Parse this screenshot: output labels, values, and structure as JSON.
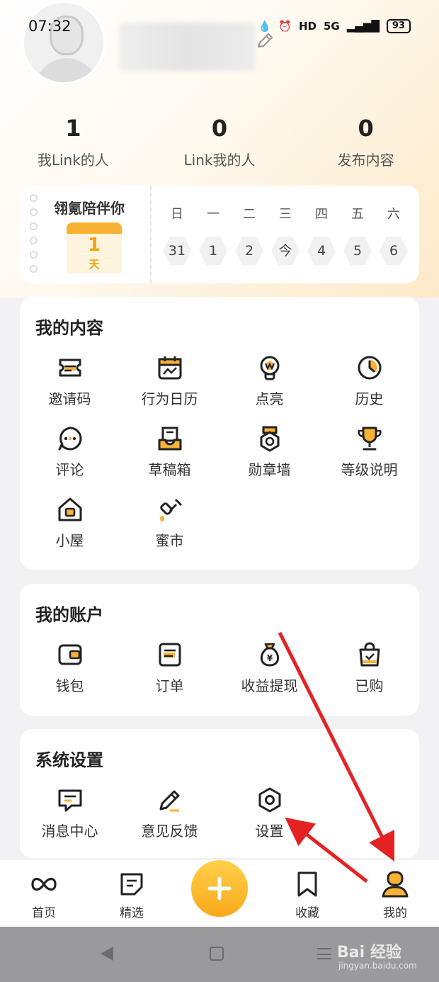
{
  "status": {
    "time": "07:32",
    "battery": "93",
    "network": "5G",
    "hd": "HD"
  },
  "profile": {
    "stats": [
      {
        "num": "1",
        "label": "我Link的人"
      },
      {
        "num": "0",
        "label": "Link我的人"
      },
      {
        "num": "0",
        "label": "发布内容"
      }
    ]
  },
  "calendar": {
    "title": "翎氪陪伴你",
    "count": "1",
    "unit": "天",
    "weekdays": [
      "日",
      "一",
      "二",
      "三",
      "四",
      "五",
      "六"
    ],
    "days": [
      "31",
      "1",
      "2",
      "今",
      "4",
      "5",
      "6"
    ]
  },
  "my_content": {
    "title": "我的内容",
    "items": [
      {
        "label": "邀请码",
        "icon": "ticket-icon"
      },
      {
        "label": "行为日历",
        "icon": "calendar-chart-icon"
      },
      {
        "label": "点亮",
        "icon": "lightbulb-icon"
      },
      {
        "label": "历史",
        "icon": "clock-icon"
      },
      {
        "label": "评论",
        "icon": "comment-icon"
      },
      {
        "label": "草稿箱",
        "icon": "drafts-icon"
      },
      {
        "label": "勋章墙",
        "icon": "medal-icon"
      },
      {
        "label": "等级说明",
        "icon": "trophy-icon"
      },
      {
        "label": "小屋",
        "icon": "house-icon"
      },
      {
        "label": "蜜市",
        "icon": "honey-dipper-icon"
      }
    ]
  },
  "my_account": {
    "title": "我的账户",
    "items": [
      {
        "label": "钱包",
        "icon": "wallet-icon"
      },
      {
        "label": "订单",
        "icon": "order-icon"
      },
      {
        "label": "收益提现",
        "icon": "money-bag-icon"
      },
      {
        "label": "已购",
        "icon": "shopping-bag-icon"
      }
    ]
  },
  "system": {
    "title": "系统设置",
    "items": [
      {
        "label": "消息中心",
        "icon": "message-icon"
      },
      {
        "label": "意见反馈",
        "icon": "pencil-icon"
      },
      {
        "label": "设置",
        "icon": "settings-hex-icon"
      }
    ]
  },
  "tabbar": {
    "items": [
      {
        "label": "首页",
        "icon": "infinity-icon"
      },
      {
        "label": "精选",
        "icon": "document-icon"
      },
      {
        "label": "收藏",
        "icon": "bookmark-icon"
      },
      {
        "label": "我的",
        "icon": "user-icon"
      }
    ]
  },
  "watermark": {
    "brand": "Bai 经验",
    "url": "jingyan.baidu.com"
  },
  "colors": {
    "accent": "#F9A91A",
    "arrow": "#E52222"
  }
}
